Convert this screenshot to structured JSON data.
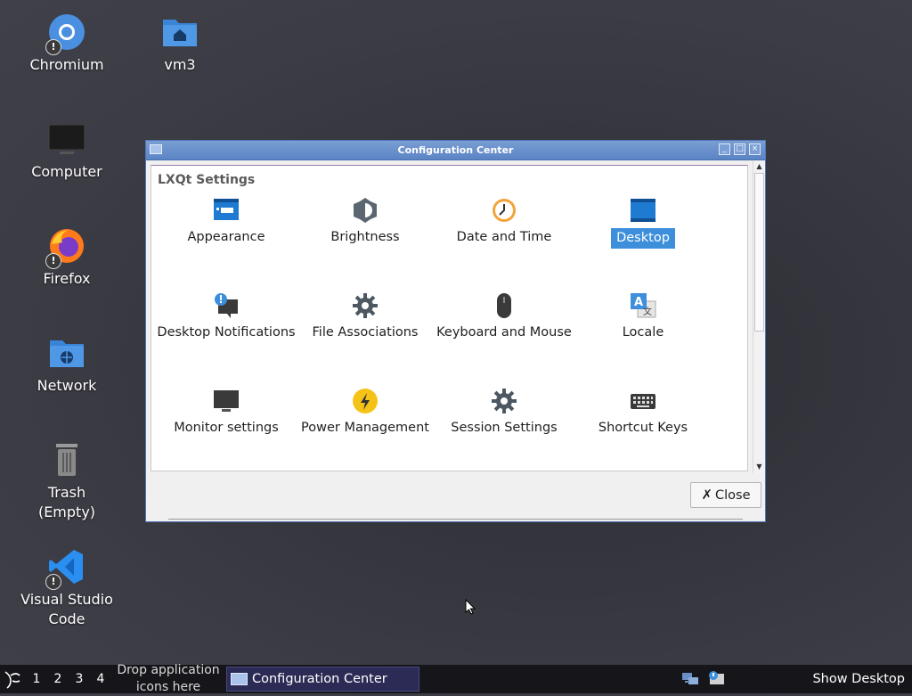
{
  "desktop": {
    "icons": [
      {
        "label": "Chromium",
        "icon": "chromium-icon"
      },
      {
        "label": "vm3",
        "icon": "home-folder-icon"
      },
      {
        "label": "Computer",
        "icon": "computer-icon"
      },
      {
        "label": "Firefox",
        "icon": "firefox-icon"
      },
      {
        "label": "Network",
        "icon": "network-folder-icon"
      },
      {
        "label": "Trash (Empty)",
        "icon": "trash-icon"
      },
      {
        "label": "Visual Studio Code",
        "icon": "vscode-icon"
      }
    ]
  },
  "window": {
    "title": "Configuration Center",
    "group_title": "LXQt Settings",
    "items": [
      {
        "label": "Appearance",
        "icon": "appearance-icon"
      },
      {
        "label": "Brightness",
        "icon": "brightness-icon"
      },
      {
        "label": "Date and Time",
        "icon": "clock-icon"
      },
      {
        "label": "Desktop",
        "icon": "desktop-icon",
        "selected": true
      },
      {
        "label": "Desktop Notifications",
        "icon": "notifications-icon"
      },
      {
        "label": "File Associations",
        "icon": "gear-icon"
      },
      {
        "label": "Keyboard and Mouse",
        "icon": "mouse-icon"
      },
      {
        "label": "Locale",
        "icon": "locale-icon"
      },
      {
        "label": "Monitor settings",
        "icon": "monitor-icon"
      },
      {
        "label": "Power Management",
        "icon": "power-icon"
      },
      {
        "label": "Session Settings",
        "icon": "gear-icon"
      },
      {
        "label": "Shortcut Keys",
        "icon": "keyboard-icon"
      }
    ],
    "close_label": "Close",
    "selected_color": "#3d8fdb"
  },
  "taskbar": {
    "workspaces": [
      "1",
      "2",
      "3",
      "4"
    ],
    "drop_hint": "Drop application icons here",
    "task_label": "Configuration Center",
    "show_desktop": "Show Desktop"
  }
}
